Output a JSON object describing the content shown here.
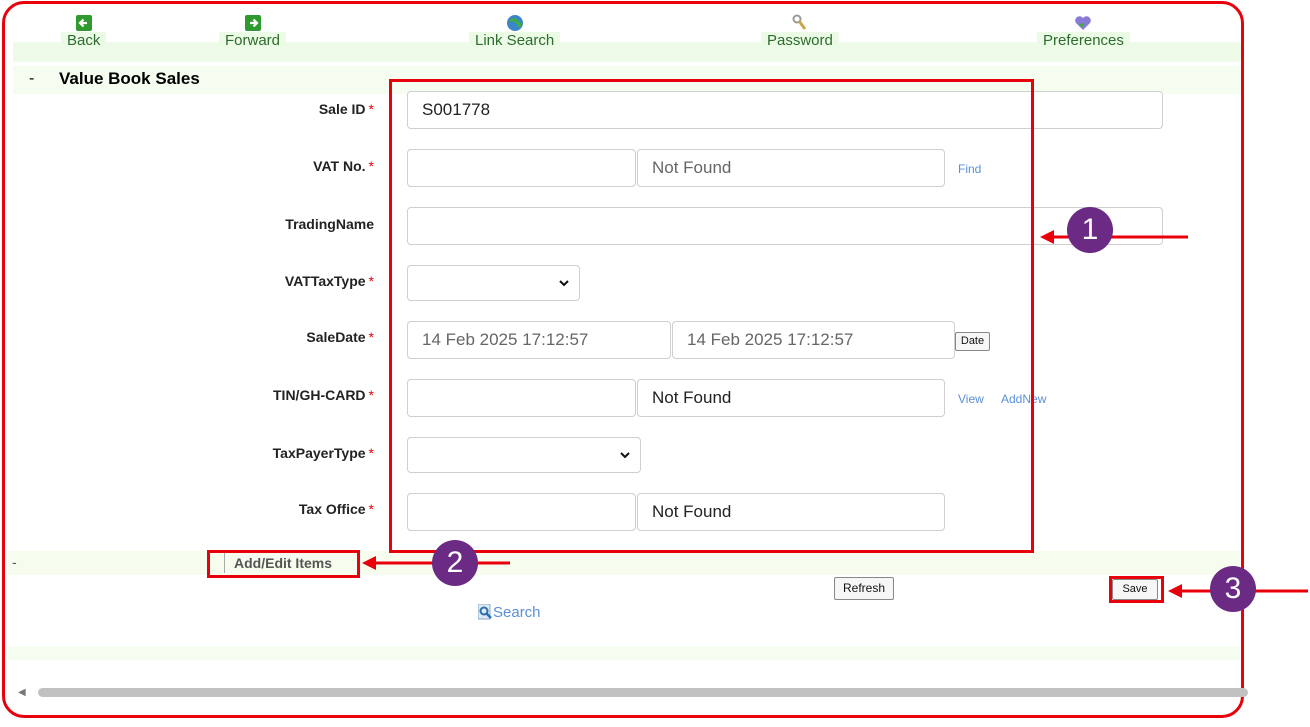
{
  "toolbar": {
    "back": "Back",
    "forward": "Forward",
    "link_search": "Link Search",
    "password": "Password",
    "preferences": "Preferences"
  },
  "section": {
    "collapse": "-",
    "title": "Value Book Sales"
  },
  "form": {
    "sale_id": {
      "label": "Sale ID",
      "value": "S001778"
    },
    "vat_no": {
      "label": "VAT No.",
      "value": "",
      "lookup": "Not Found",
      "find": "Find"
    },
    "trading_name": {
      "label": "TradingName",
      "value": ""
    },
    "vat_tax_type": {
      "label": "VATTaxType",
      "selected": ""
    },
    "sale_date": {
      "label": "SaleDate",
      "value1": "14 Feb 2025 17:12:57",
      "value2": "14 Feb 2025 17:12:57",
      "date_button": "Date"
    },
    "tin": {
      "label": "TIN/GH-CARD",
      "value": "",
      "lookup": "Not Found",
      "view": "View",
      "add_new": "AddNew"
    },
    "taxpayer_type": {
      "label": "TaxPayerType",
      "selected": ""
    },
    "tax_office": {
      "label": "Tax Office",
      "value": "",
      "lookup": "Not Found"
    },
    "required_mark": "*"
  },
  "items": {
    "collapse": "-",
    "title": "Add/Edit  Items"
  },
  "actions": {
    "refresh": "Refresh",
    "save": "Save",
    "search": "Search"
  },
  "callouts": [
    "1",
    "2",
    "3"
  ],
  "colors": {
    "callout_red": "#e8000b",
    "badge_purple": "#6b2a83",
    "link_blue": "#5b8fd8",
    "toolbar_green": "#2e6b2e"
  }
}
